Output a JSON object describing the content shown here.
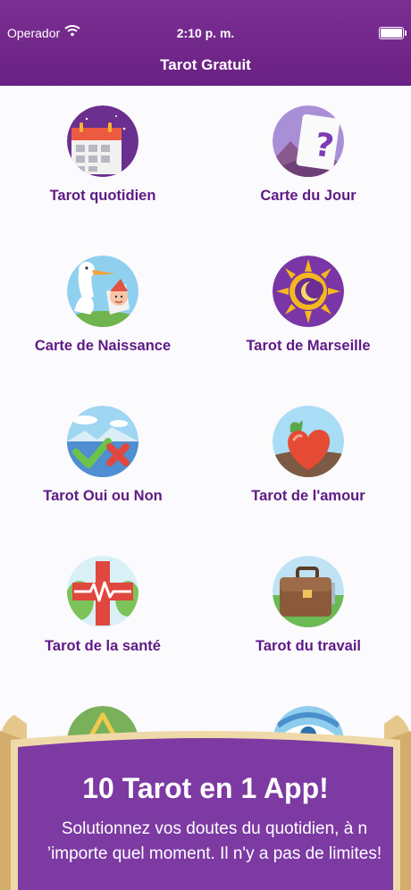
{
  "status_bar": {
    "carrier": "Operador",
    "time": "2:10 p. m."
  },
  "nav": {
    "title": "Tarot Gratuit"
  },
  "tiles": [
    {
      "label": "Tarot quotidien",
      "icon": "calendar-icon"
    },
    {
      "label": "Carte du Jour",
      "icon": "question-card-icon"
    },
    {
      "label": "Carte de Naissance",
      "icon": "stork-baby-icon"
    },
    {
      "label": "Tarot de Marseille",
      "icon": "sun-moon-icon"
    },
    {
      "label": "Tarot Oui ou Non",
      "icon": "check-cross-icon"
    },
    {
      "label": "Tarot de l'amour",
      "icon": "heart-icon"
    },
    {
      "label": "Tarot de la santé",
      "icon": "health-cross-icon"
    },
    {
      "label": "Tarot du travail",
      "icon": "briefcase-icon"
    }
  ],
  "banner": {
    "headline": "10 Tarot en 1 App!",
    "subtitle": "Solutionnez vos doutes du quotidien, à n ’importe quel moment. Il n'y a pas de limites!"
  },
  "colors": {
    "primary": "#6a2183",
    "label": "#5e1a86",
    "banner": "#7d3aa3",
    "parchment": "#e9cf97"
  }
}
